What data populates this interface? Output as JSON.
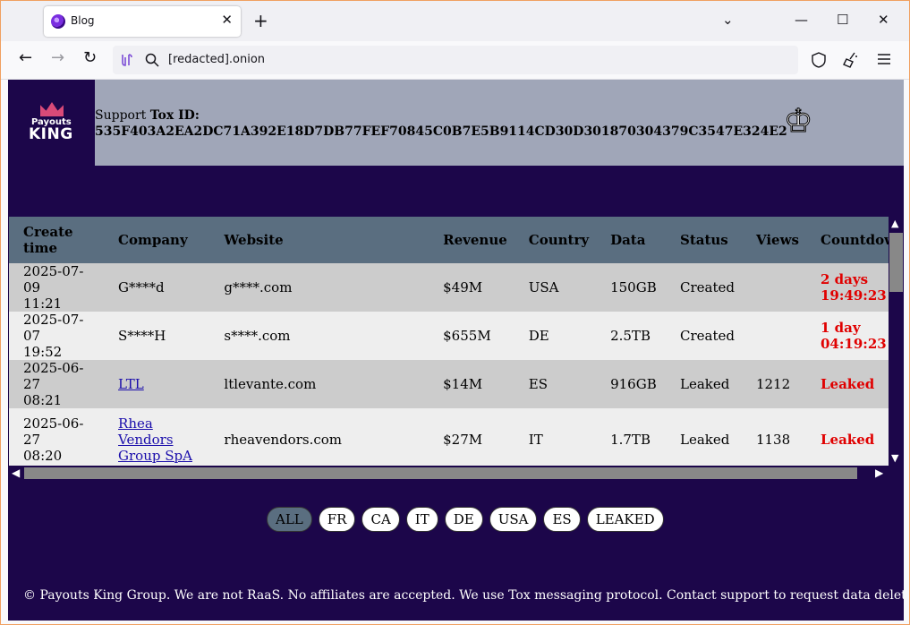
{
  "browser": {
    "tab_title": "Blog",
    "tab_close": "✕",
    "new_tab": "+",
    "url": "[redacted].onion",
    "window_controls": {
      "list": "⌄",
      "minimize": "—",
      "maximize": "☐",
      "close": "✕"
    },
    "nav": {
      "back": "←",
      "forward": "→",
      "reload": "↻"
    },
    "icons": [
      "privacy-icon",
      "search-icon",
      "shield-icon",
      "broom-icon",
      "menu-icon"
    ]
  },
  "site": {
    "logo": {
      "top": "Payouts",
      "bottom": "KING"
    },
    "support_label_plain": "Support ",
    "support_label_bold": "Tox ID:",
    "tox_id": "535F403A2EA2DC71A392E18D7DB77FEF70845C0B7E5B9114CD30D301870304379C3547E324E2"
  },
  "table": {
    "headers": [
      "Create time",
      "Company",
      "Website",
      "Revenue",
      "Country",
      "Data",
      "Status",
      "Views",
      "Countdown"
    ],
    "rows": [
      {
        "date": "2025-07-09",
        "time": "11:21",
        "company": "G****d",
        "company_link": false,
        "website": "g****.com",
        "revenue": "$49M",
        "country": "USA",
        "data": "150GB",
        "status": "Created",
        "views": "",
        "countdown_line1": "2 days",
        "countdown_line2": "19:49:23"
      },
      {
        "date": "2025-07-07",
        "time": "19:52",
        "company": "S****H",
        "company_link": false,
        "website": "s****.com",
        "revenue": "$655M",
        "country": "DE",
        "data": "2.5TB",
        "status": "Created",
        "views": "",
        "countdown_line1": "1 day",
        "countdown_line2": "04:19:23"
      },
      {
        "date": "2025-06-27",
        "time": "08:21",
        "company": "LTL",
        "company_link": true,
        "website": "ltlevante.com",
        "revenue": "$14M",
        "country": "ES",
        "data": "916GB",
        "status": "Leaked",
        "views": "1212",
        "countdown_line1": "Leaked",
        "countdown_line2": ""
      },
      {
        "date": "2025-06-27",
        "time": "08:20",
        "company_lines": [
          "Rhea",
          "Vendors",
          "Group SpA"
        ],
        "company_link": true,
        "website": "rheavendors.com",
        "revenue": "$27M",
        "country": "IT",
        "data": "1.7TB",
        "status": "Leaked",
        "views": "1138",
        "countdown_line1": "Leaked",
        "countdown_line2": ""
      }
    ]
  },
  "filters": [
    "ALL",
    "FR",
    "CA",
    "IT",
    "DE",
    "USA",
    "ES",
    "LEAKED"
  ],
  "active_filter": "ALL",
  "footer": "© Payouts King Group. We are not RaaS. No affiliates are accepted. We use Tox messaging protocol. Contact support to request data deletion.",
  "colors": {
    "page_bg": "#1c064a",
    "header_band": "#a0a6b8",
    "table_header": "#5a6e80",
    "countdown_red": "#e00000"
  }
}
